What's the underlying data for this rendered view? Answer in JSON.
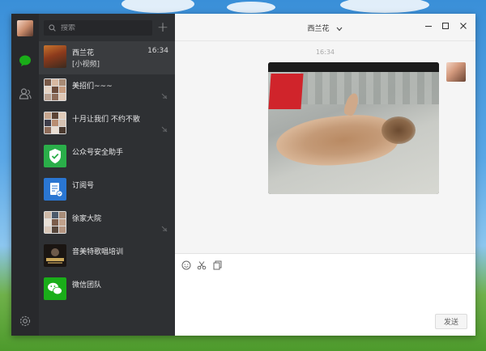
{
  "desktop": {
    "wallpaper": "windows-xp-bliss"
  },
  "nav": {
    "items": [
      {
        "icon": "chat-icon",
        "active": true
      },
      {
        "icon": "contacts-icon",
        "active": false
      },
      {
        "icon": "settings-icon",
        "active": false
      }
    ]
  },
  "search": {
    "placeholder": "搜索",
    "value": ""
  },
  "add_label": "+",
  "chats": [
    {
      "name": "西兰花",
      "preview": "[小视频]",
      "time": "16:34",
      "active": true,
      "muted": false
    },
    {
      "name": "美招们~~~",
      "preview": "",
      "time": "",
      "active": false,
      "muted": true
    },
    {
      "name": "十月让我们 不约不散",
      "preview": "",
      "time": "",
      "active": false,
      "muted": true
    },
    {
      "name": "公众号安全助手",
      "preview": "",
      "time": "",
      "active": false,
      "muted": false
    },
    {
      "name": "订阅号",
      "preview": "",
      "time": "",
      "active": false,
      "muted": false
    },
    {
      "name": "徐家大院",
      "preview": "",
      "time": "",
      "active": false,
      "muted": true
    },
    {
      "name": "音美特歌唱培训",
      "preview": "",
      "time": "",
      "active": false,
      "muted": false
    },
    {
      "name": "微信团队",
      "preview": "",
      "time": "",
      "active": false,
      "muted": false
    }
  ],
  "conversation": {
    "title": "西兰花",
    "timestamp": "16:34",
    "message_type": "video"
  },
  "composer": {
    "send_label": "发送"
  },
  "colors": {
    "nav_bg": "#28292c",
    "list_bg": "#2e3033",
    "list_active": "#3a3c3f",
    "accent_green": "#1aad19",
    "panel_bg": "#f5f5f5"
  }
}
